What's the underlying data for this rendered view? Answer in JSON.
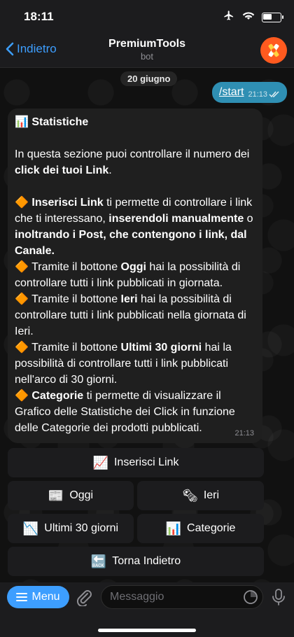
{
  "status_bar": {
    "time": "18:11"
  },
  "nav": {
    "back_label": "Indietro",
    "title": "PremiumTools",
    "subtitle": "bot"
  },
  "chat": {
    "date": "20 giugno",
    "outgoing": {
      "text": "/start",
      "time": "21:13"
    },
    "incoming": {
      "time": "21:13",
      "heading_emoji": "📊",
      "heading": "Statistiche",
      "intro_1": "In questa sezione puoi controllare il numero dei ",
      "intro_bold": "click dei tuoi Link",
      "intro_2": ".",
      "bullet": "🔶",
      "p1_bold_1": "Inserisci Link",
      "p1_1": " ti permette di controllare i link che ti interessano, ",
      "p1_bold_2": "inserendoli manualmente",
      "p1_2": " o ",
      "p1_bold_3": "inoltrando i Post, che contengono i link, dal Canale.",
      "p2_1": " Tramite il bottone ",
      "p2_bold": "Oggi",
      "p2_2": " hai la possibilità di controllare tutti i link pubblicati in giornata.",
      "p3_1": " Tramite il bottone ",
      "p3_bold": "Ieri",
      "p3_2": " hai la possibilità di controllare tutti i link pubblicati nella giornata di Ieri.",
      "p4_1": " Tramite il bottone ",
      "p4_bold": "Ultimi 30 giorni",
      "p4_2": " hai la possibilità di controllare tutti i link pubblicati nell'arco di 30 giorni.",
      "p5_bold": "Categorie",
      "p5_1": " ti permette di visualizzare il Grafico delle Statistiche dei Click in funzione delle Categorie dei prodotti pubblicati."
    }
  },
  "keyboard": {
    "inserisci": {
      "emoji": "📈",
      "label": "Inserisci Link"
    },
    "oggi": {
      "emoji": "📰",
      "label": "Oggi"
    },
    "ieri": {
      "emoji": "🗞",
      "label": "Ieri"
    },
    "ultimi": {
      "emoji": "📉",
      "label": "Ultimi 30 giorni"
    },
    "categorie": {
      "emoji": "📊",
      "label": "Categorie"
    },
    "torna": {
      "emoji": "🔙",
      "label": "Torna Indietro"
    }
  },
  "input": {
    "menu_label": "Menu",
    "placeholder": "Messaggio"
  },
  "colors": {
    "accent": "#3d9eff",
    "outgoing_bubble": "#2f8fb3",
    "incoming_bubble": "#1f1f1f"
  }
}
